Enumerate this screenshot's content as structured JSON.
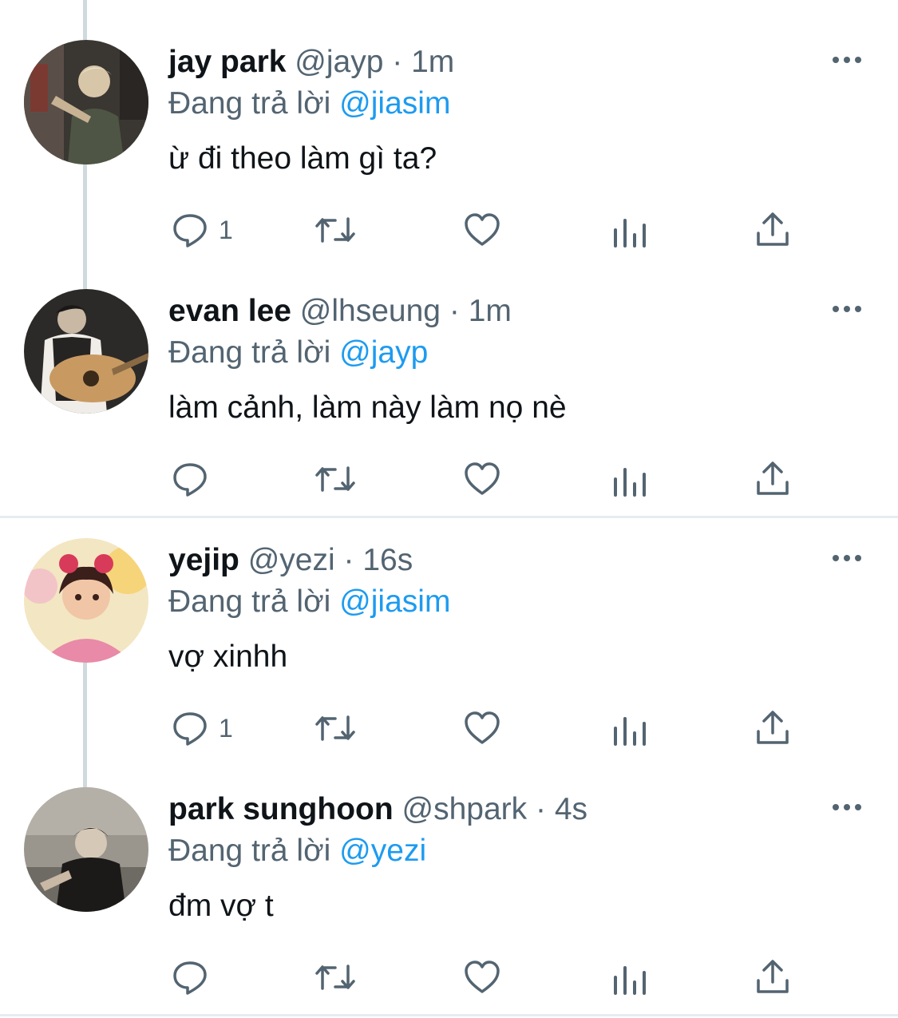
{
  "tweets": [
    {
      "name": "jay park",
      "handle": "@jayp",
      "dot": "·",
      "time": "1m",
      "reply_prefix": "Đang trả lời",
      "reply_to": "@jiasim",
      "text": "ừ đi theo làm gì ta?",
      "reply_count": "1"
    },
    {
      "name": "evan lee",
      "handle": "@lhseung",
      "dot": "·",
      "time": "1m",
      "reply_prefix": "Đang trả lời",
      "reply_to": "@jayp",
      "text": "làm cảnh, làm này làm nọ nè",
      "reply_count": ""
    },
    {
      "name": "yejip",
      "handle": "@yezi",
      "dot": "·",
      "time": "16s",
      "reply_prefix": "Đang trả lời",
      "reply_to": "@jiasim",
      "text": "vợ xinhh",
      "reply_count": "1"
    },
    {
      "name": "park sunghoon",
      "handle": "@shpark",
      "dot": "·",
      "time": "4s",
      "reply_prefix": "Đang trả lời",
      "reply_to": "@yezi",
      "text": "đm vợ t",
      "reply_count": ""
    }
  ],
  "icons": {
    "reply": "reply-icon",
    "retweet": "retweet-icon",
    "like": "like-icon",
    "views": "views-icon",
    "share": "share-icon",
    "more": "more-icon"
  },
  "colors": {
    "name": "#0f1419",
    "secondary": "#536471",
    "mention": "#1d9bf0",
    "thread_line": "#cfd9de"
  }
}
